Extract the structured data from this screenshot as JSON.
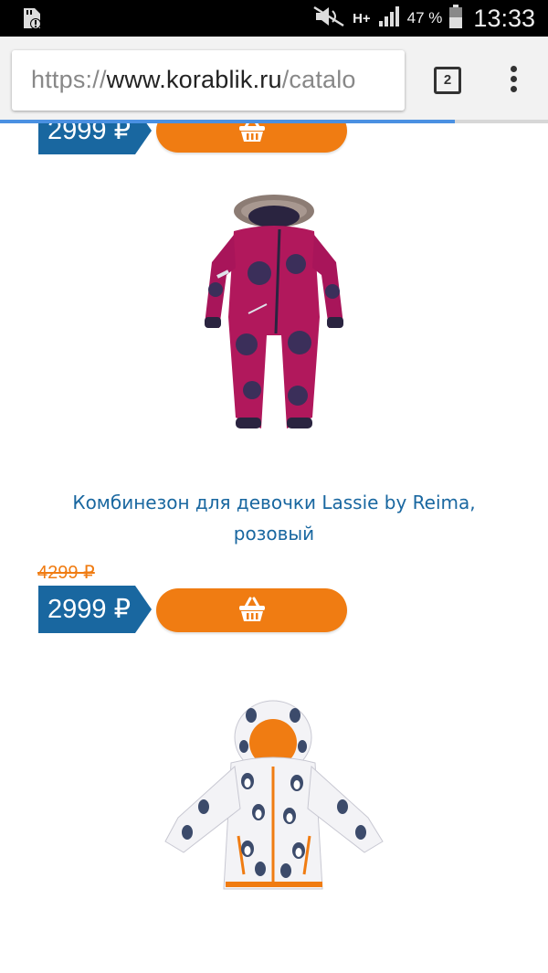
{
  "status_bar": {
    "network": "H+",
    "battery_percent": "47 %",
    "time": "13:33"
  },
  "browser": {
    "url_scheme": "https://",
    "url_domain": "www.korablik.ru",
    "url_path": "/catalo",
    "tab_count": "2",
    "load_progress": 0.83
  },
  "products": [
    {
      "price": "2999 ₽",
      "cart_icon": "basket-icon"
    },
    {
      "title": "Комбинезон для девочки Lassie by Reima, розовый",
      "old_price": "4299 ₽",
      "price": "2999 ₽",
      "image_icon": "pink-snowsuit-image",
      "cart_icon": "basket-icon"
    },
    {
      "image_icon": "penguin-jacket-image"
    }
  ],
  "colors": {
    "price_tag": "#1967a0",
    "accent": "#f07c12",
    "title_link": "#1967a0"
  }
}
